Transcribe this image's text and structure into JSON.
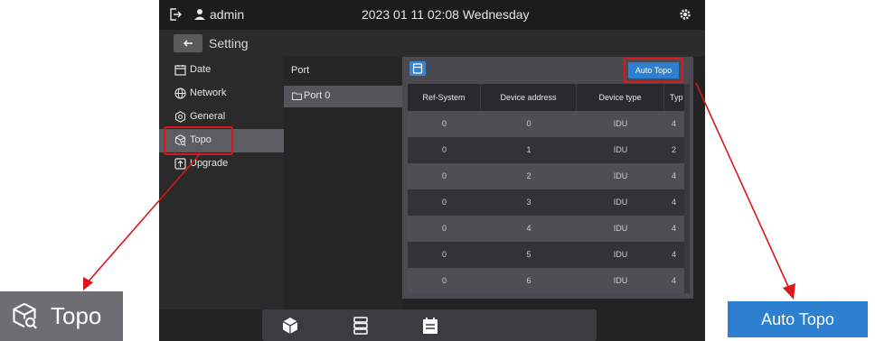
{
  "topbar": {
    "user": "admin",
    "datetime": "2023 01 11 02:08 Wednesday",
    "icons": [
      "logout-icon",
      "user-icon",
      "gear-icon"
    ]
  },
  "setting_bar": {
    "title": "Setting",
    "back_icon": "return-icon"
  },
  "sidebar": {
    "items": [
      {
        "label": "Date",
        "icon": "calendar-icon"
      },
      {
        "label": "Network",
        "icon": "globe-icon"
      },
      {
        "label": "General",
        "icon": "gear-icon"
      },
      {
        "label": "Topo",
        "icon": "topo-icon",
        "active": true
      },
      {
        "label": "Upgrade",
        "icon": "upgrade-icon"
      }
    ]
  },
  "port_panel": {
    "header": "Port",
    "items": [
      {
        "label": "Port 0",
        "icon": "folder-icon"
      }
    ]
  },
  "toolbar": {
    "save_icon": "save-icon",
    "auto_topo_label": "Auto Topo"
  },
  "table": {
    "headers": [
      "Ref-System",
      "Device address",
      "Device type",
      "Typ"
    ],
    "rows": [
      [
        "0",
        "0",
        "IDU",
        "4"
      ],
      [
        "0",
        "1",
        "IDU",
        "2"
      ],
      [
        "0",
        "2",
        "IDU",
        "4"
      ],
      [
        "0",
        "3",
        "IDU",
        "4"
      ],
      [
        "0",
        "4",
        "IDU",
        "4"
      ],
      [
        "0",
        "5",
        "IDU",
        "4"
      ],
      [
        "0",
        "6",
        "IDU",
        "4"
      ]
    ]
  },
  "bottom_nav": {
    "icons": [
      "cube-icon",
      "server-icon",
      "calendar-icon"
    ]
  },
  "zoom_callouts": {
    "topo_label": "Topo",
    "auto_topo_label": "Auto Topo"
  },
  "colors": {
    "accent_blue": "#2d7fd0",
    "highlight_red": "#d9171c",
    "screen_bg": "#232323"
  }
}
